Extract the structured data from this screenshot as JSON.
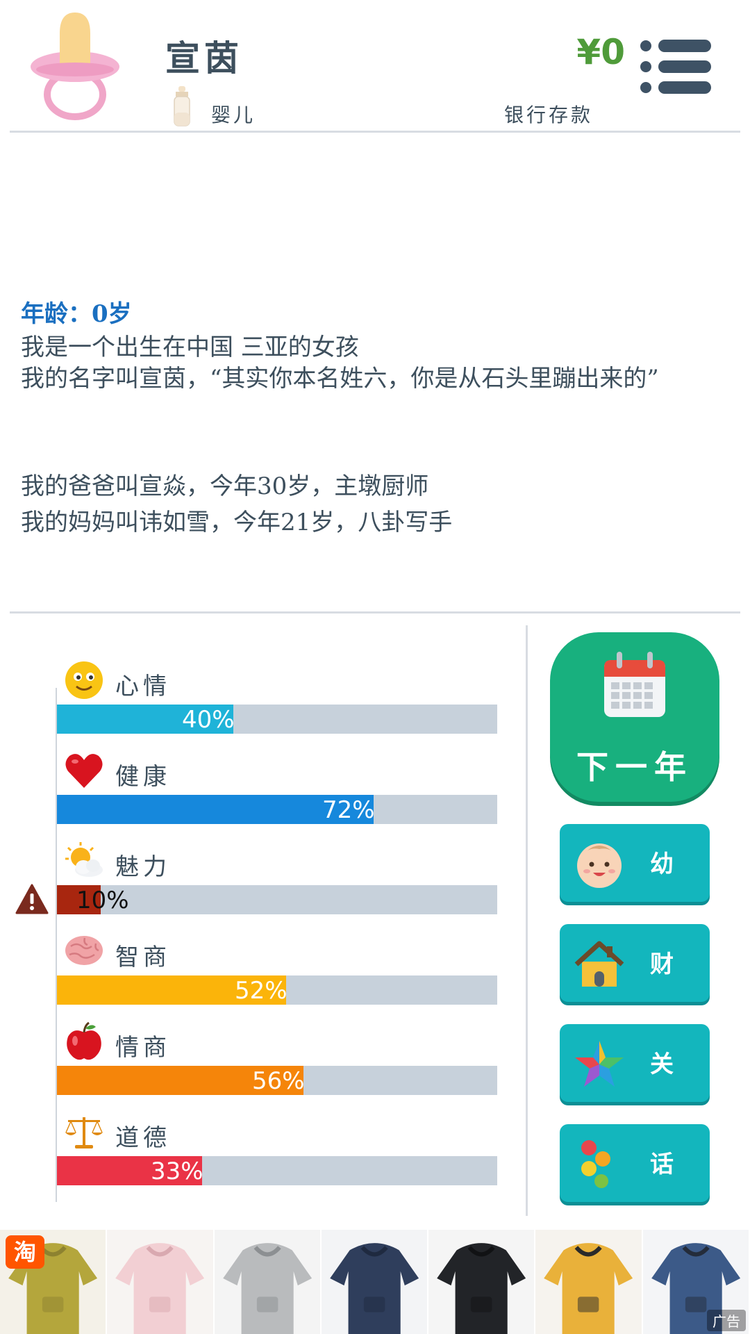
{
  "header": {
    "name": "宣茵",
    "stage": "婴儿",
    "money": "¥0",
    "bank_label": "银行存款"
  },
  "story": {
    "age_line": "年龄：0岁",
    "lines": [
      "我是一个出生在中国 三亚的女孩",
      "我的名字叫宣茵，“其实你本名姓六，你是从石头里蹦出来的”",
      "",
      "我的爸爸叫宣焱，今年30岁，主墩厨师",
      "我的妈妈叫讳如雪，今年21岁，八卦写手"
    ]
  },
  "stats": [
    {
      "label": "心情",
      "icon": "smiley-icon",
      "value": 40,
      "pct": "40%",
      "color": "#1fb3d8"
    },
    {
      "label": "健康",
      "icon": "heart-icon",
      "value": 72,
      "pct": "72%",
      "color": "#1688dc"
    },
    {
      "label": "魅力",
      "icon": "sun-cloud-icon",
      "value": 10,
      "pct": "10%",
      "color": "#a8260f",
      "warning": true
    },
    {
      "label": "智商",
      "icon": "brain-icon",
      "value": 52,
      "pct": "52%",
      "color": "#fbb40a"
    },
    {
      "label": "情商",
      "icon": "apple-icon",
      "value": 56,
      "pct": "56%",
      "color": "#f5850a"
    },
    {
      "label": "道德",
      "icon": "scales-icon",
      "value": 33,
      "pct": "33%",
      "color": "#ea3346"
    }
  ],
  "actions": {
    "next_year": "下一年",
    "buttons": [
      {
        "label": "幼",
        "icon": "baby-face-icon"
      },
      {
        "label": "财",
        "icon": "house-icon"
      },
      {
        "label": "关",
        "icon": "star-icon"
      },
      {
        "label": "话",
        "icon": "dots-icon"
      }
    ]
  },
  "ad": {
    "badge": "淘",
    "label": "广告",
    "items": [
      "olive hoodie",
      "pink hoodie",
      "grey hoodie",
      "navy hoodie",
      "black outfit",
      "yellow outfit",
      "denim outfit"
    ]
  },
  "colors": {
    "accent_green": "#18b07e",
    "button_teal": "#13b6bd",
    "money_green": "#4f9b3a",
    "age_blue": "#1a6fc0",
    "bar_track": "#c7d1db"
  }
}
